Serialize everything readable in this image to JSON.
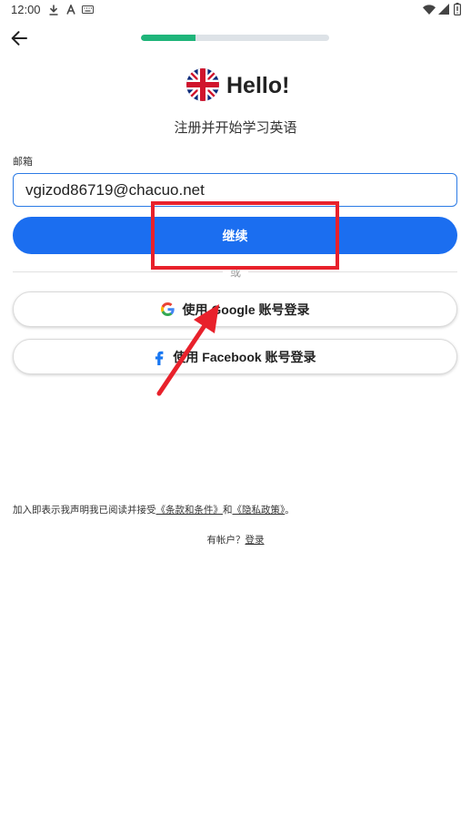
{
  "status_bar": {
    "time": "12:00"
  },
  "header": {
    "progress": 0.29
  },
  "brand": {
    "greeting": "Hello!",
    "subtitle": "注册并开始学习英语"
  },
  "form": {
    "email_label": "邮箱",
    "email_value": "vgizod86719@chacuo.net",
    "continue_label": "继续"
  },
  "divider": {
    "or_text": "或"
  },
  "social": {
    "google_label": "使用 Google 账号登录",
    "facebook_label": "使用 Facebook 账号登录"
  },
  "legal": {
    "prefix": "加入即表示我声明我已阅读并接受",
    "terms_link": "《条款和条件》",
    "conjunction": "和",
    "privacy_link": "《隐私政策》",
    "suffix": "。"
  },
  "login_prompt": {
    "text": "有帐户？",
    "link": "登录"
  },
  "colors": {
    "primary": "#1b6ef0",
    "progress": "#1fb57a",
    "annotation": "#e8212b"
  }
}
